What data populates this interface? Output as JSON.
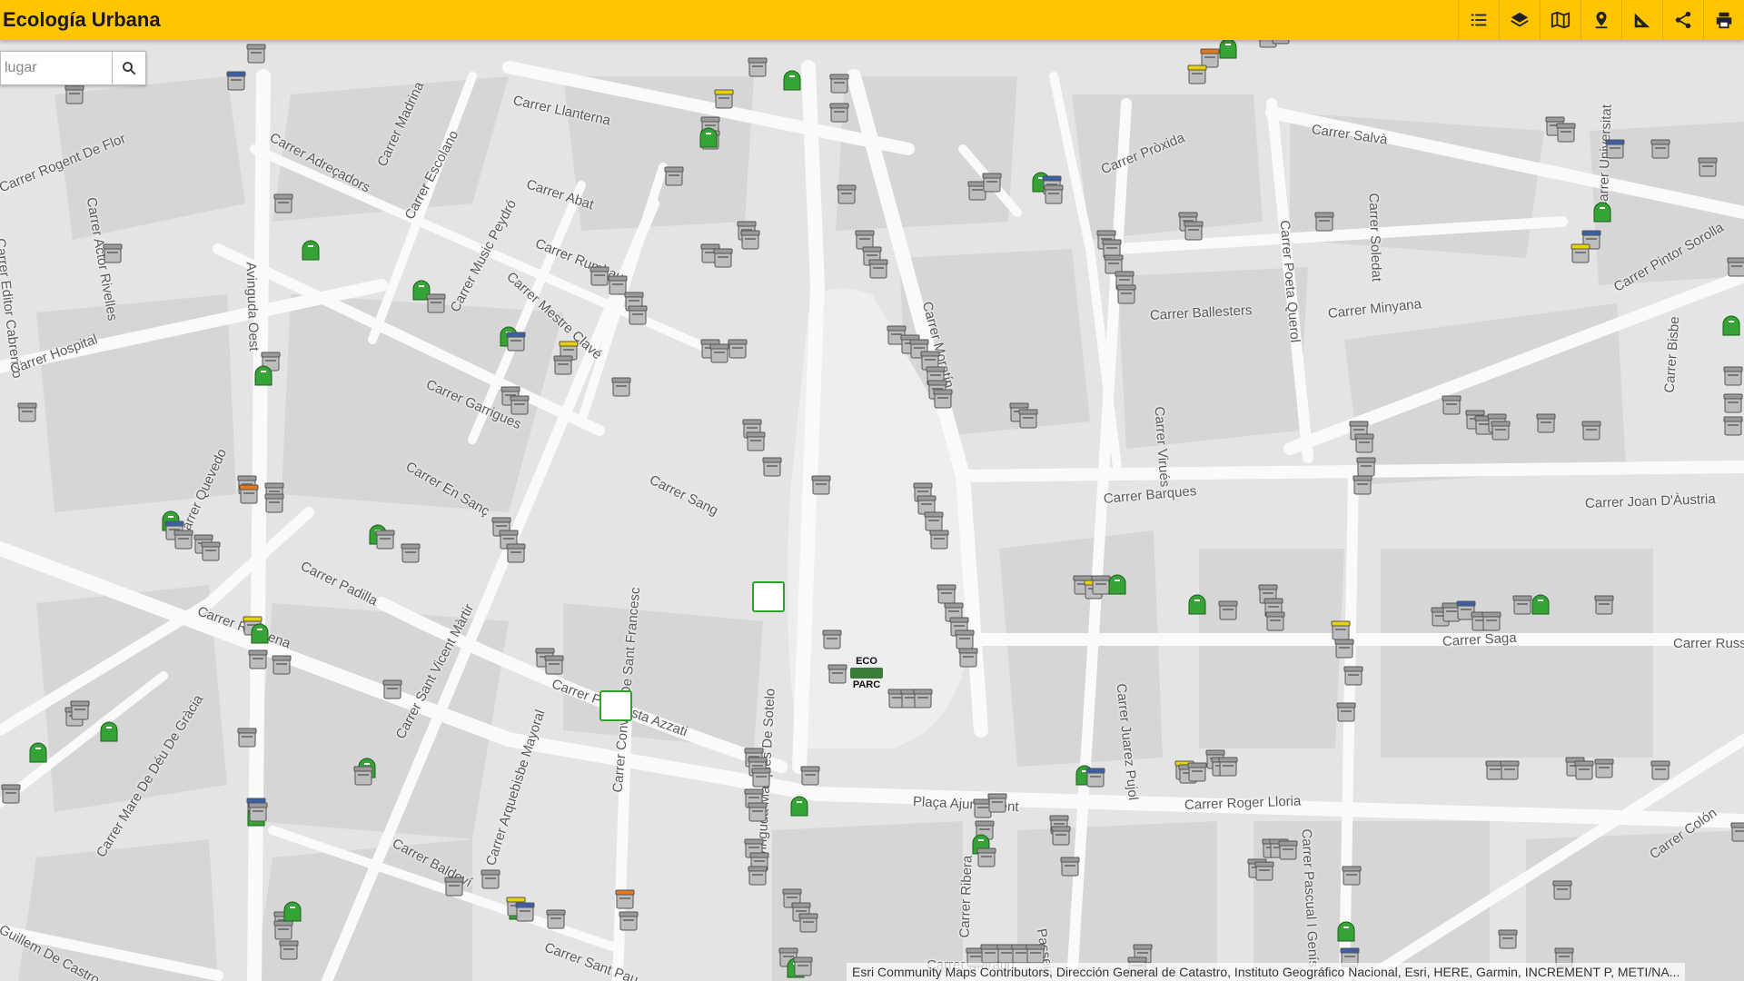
{
  "app": {
    "title": "Ecología Urbana"
  },
  "toolbar": {
    "tools": [
      {
        "name": "list-icon"
      },
      {
        "name": "layers-icon"
      },
      {
        "name": "basemap-icon"
      },
      {
        "name": "location-icon"
      },
      {
        "name": "measure-icon"
      },
      {
        "name": "share-icon"
      },
      {
        "name": "print-icon"
      }
    ]
  },
  "search": {
    "value": "lugar"
  },
  "map": {
    "attribution": "Esri Community Maps Contributors, Dirección General de Catastro, Instituto Geográfico Nacional, Esri, HERE, Garmin, INCREMENT P, METI/NA...",
    "ecoparc_line1": "ECO",
    "ecoparc_line2": "PARC",
    "streets": [
      "Carrer Llanterna",
      "Carrer Abat",
      "Carrer Rumbau",
      "Carrer Adreçadors",
      "Carrer Madrina",
      "Carrer Escolano",
      "Carrer Rogent De Flor",
      "Carrer Actor Rivelles",
      "Carrer Editor Cabrerizo",
      "Carrer Hospital",
      "Avinguda Oest",
      "Carrer Garrigues",
      "Carrer Music Peydró",
      "Carrer Mestre Clavé",
      "Plaça Ajuntament",
      "Carrer Quevedo",
      "Carrer En Sanç",
      "Carrer Sang",
      "Carrer Padilla",
      "Carrer Sant Vicent Màrtir",
      "Carrer Periodista Azzati",
      "Carrer Arquebisbe Mayoral",
      "Carrer Convent De Sant Francesc",
      "Carrer Mare De Déu De Gràcia",
      "Carrer Baldoví",
      "Guillem De Castro",
      "Avinguda Marqués De Sotelo",
      "Carrer Salvà",
      "Carrer Pròxida",
      "Carrer Poeta Querol",
      "Carrer Soledat",
      "Carrer Minyana",
      "Carrer Universitat",
      "Carrer Pintor Sorolla",
      "Carrer Bisbe",
      "Carrer Barques",
      "Carrer Joan D'Àustria",
      "Carrer Virués",
      "Carrer Moratín",
      "Carrer Ballesters",
      "Carrer Roger Lloria",
      "Carrer Pascual I Genís",
      "Carrer Colón",
      "Passeig Ruzafa",
      "Carrer Ribera",
      "Carrer Juarez Pujol",
      "Carrer Saga",
      "Carrer Russafa",
      "Carrer Sant Pau",
      "Carrer Requena",
      "Carrer Moratin"
    ]
  }
}
